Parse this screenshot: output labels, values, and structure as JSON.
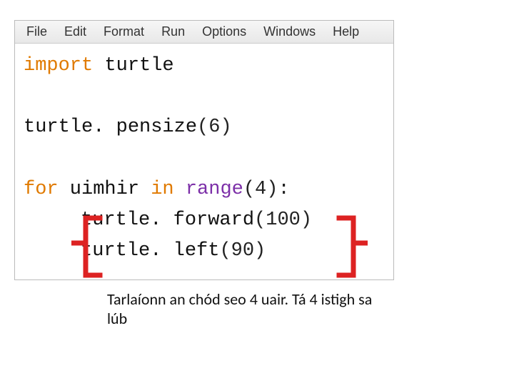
{
  "menubar": {
    "items": [
      "File",
      "Edit",
      "Format",
      "Run",
      "Options",
      "Windows",
      "Help"
    ]
  },
  "code": {
    "line1": {
      "kw": "import",
      "rest": " turtle"
    },
    "line2": "turtle. pensize",
    "line2_paren": "(6)",
    "line3": {
      "kw": "for",
      "var": " uimhir ",
      "in": "in",
      "sp": " ",
      "range": "range",
      "paren": "(4):"
    },
    "line4": "turtle. forward",
    "line4_paren": "(100)",
    "line5": "turtle. left",
    "line5_paren": "(90)"
  },
  "annotation": "Tarlaíonn an chód seo 4 uair. Tá 4 istigh sa lúb"
}
